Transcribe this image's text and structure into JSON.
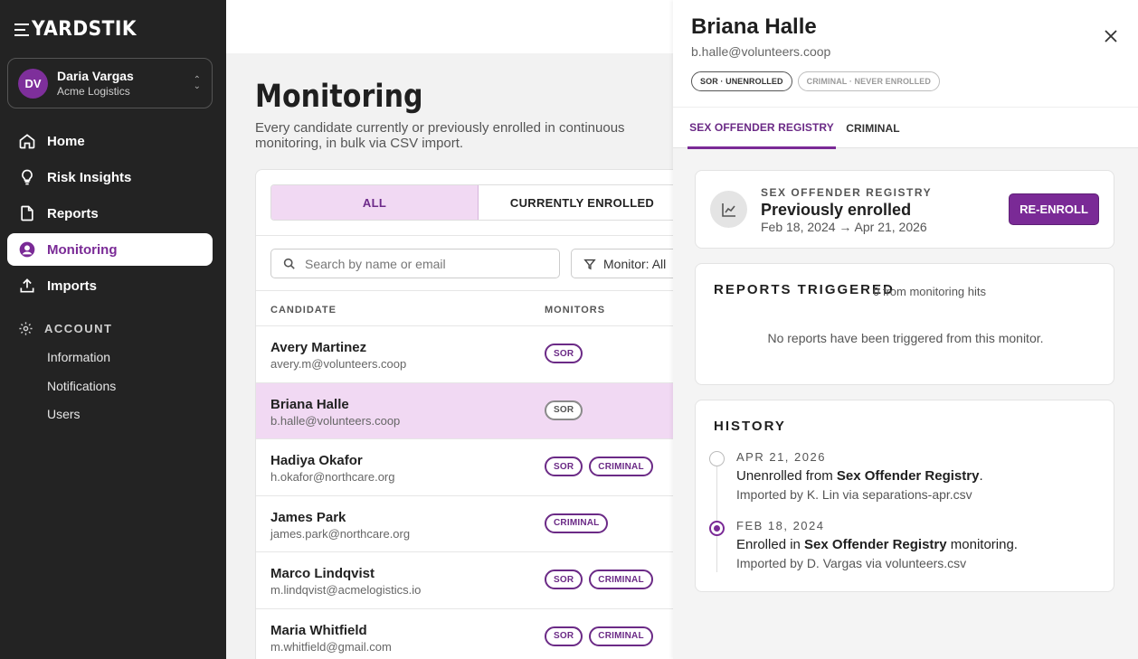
{
  "brand": {
    "name": "YARDSTIK"
  },
  "account": {
    "initials": "DV",
    "name": "Daria Vargas",
    "org": "Acme Logistics"
  },
  "nav": {
    "items": [
      {
        "label": "Home",
        "icon": "home-icon"
      },
      {
        "label": "Risk Insights",
        "icon": "lightbulb-icon"
      },
      {
        "label": "Reports",
        "icon": "document-icon"
      },
      {
        "label": "Monitoring",
        "icon": "user-circle-icon",
        "active": true
      },
      {
        "label": "Imports",
        "icon": "upload-icon"
      }
    ],
    "section": "ACCOUNT",
    "sub_items": [
      "Information",
      "Notifications",
      "Users"
    ]
  },
  "page": {
    "title": "Monitoring",
    "description": "Every candidate currently or previously enrolled in continuous monitoring, in bulk via CSV import."
  },
  "segments": [
    "ALL",
    "CURRENTLY ENROLLED"
  ],
  "search": {
    "placeholder": "Search by name or email"
  },
  "monitor_filter": {
    "label": "Monitor: All"
  },
  "table": {
    "columns": [
      "CANDIDATE",
      "MONITORS"
    ],
    "rows": [
      {
        "name": "Avery Martinez",
        "email": "avery.m@volunteers.coop",
        "monitors": [
          "SOR"
        ]
      },
      {
        "name": "Briana Halle",
        "email": "b.halle@volunteers.coop",
        "monitors": [
          "SOR"
        ],
        "selected": true
      },
      {
        "name": "Hadiya Okafor",
        "email": "h.okafor@northcare.org",
        "monitors": [
          "SOR",
          "CRIMINAL"
        ]
      },
      {
        "name": "James Park",
        "email": "james.park@northcare.org",
        "monitors": [
          "CRIMINAL"
        ]
      },
      {
        "name": "Marco Lindqvist",
        "email": "m.lindqvist@acmelogistics.io",
        "monitors": [
          "SOR",
          "CRIMINAL"
        ]
      },
      {
        "name": "Maria Whitfield",
        "email": "m.whitfield@gmail.com",
        "monitors": [
          "SOR",
          "CRIMINAL"
        ]
      }
    ]
  },
  "drawer": {
    "name": "Briana Halle",
    "email": "b.halle@volunteers.coop",
    "status_pills": [
      "SOR · UNENROLLED",
      "CRIMINAL · NEVER ENROLLED"
    ],
    "tabs": [
      "SEX OFFENDER REGISTRY",
      "CRIMINAL"
    ],
    "enrollment": {
      "label": "SEX OFFENDER REGISTRY",
      "state": "Previously enrolled",
      "range": "Feb 18, 2024 → Apr 21, 2026",
      "action": "RE-ENROLL"
    },
    "reports": {
      "title": "REPORTS TRIGGERED",
      "subtitle": "0 from monitoring hits",
      "empty": "No reports have been triggered from this monitor."
    },
    "history": {
      "title": "HISTORY",
      "events": [
        {
          "date": "APR 21, 2026",
          "prefix": "Unenrolled from ",
          "bold": "Sex Offender Registry",
          "suffix": ".",
          "detail": "Imported by K. Lin via separations-apr.csv"
        },
        {
          "date": "FEB 18, 2024",
          "prefix": "Enrolled in ",
          "bold": "Sex Offender Registry",
          "suffix": " monitoring.",
          "detail": "Imported by D. Vargas via volunteers.csv"
        }
      ]
    }
  },
  "colors": {
    "accent": "#7a2a96",
    "accent_light": "#f1d9f3",
    "sidebar": "#232323"
  }
}
